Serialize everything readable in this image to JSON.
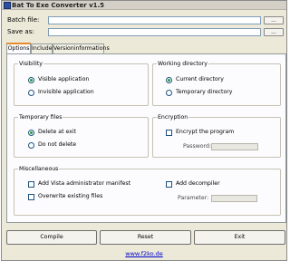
{
  "window": {
    "title": "Bat To Exe Converter v1.5"
  },
  "fields": {
    "batch_label": "Batch file:",
    "batch_value": "",
    "batch_browse": "...",
    "save_label": "Save as:",
    "save_value": "",
    "save_browse": "..."
  },
  "tabs": [
    {
      "label": "Options",
      "active": true
    },
    {
      "label": "Include",
      "active": false
    },
    {
      "label": "Versioninformations",
      "active": false
    }
  ],
  "visibility": {
    "title": "Visibility",
    "options": [
      "Visible application",
      "Invisible application"
    ],
    "selected": "Visible application"
  },
  "working_directory": {
    "title": "Working directory",
    "options": [
      "Current directory",
      "Temporary directory"
    ],
    "selected": "Current directory"
  },
  "temporary_files": {
    "title": "Temporary files",
    "options": [
      "Delete at exit",
      "Do not delete"
    ],
    "selected": "Delete at exit"
  },
  "encryption": {
    "title": "Encryption",
    "checkbox": "Encrypt the program",
    "checked": false,
    "password_label": "Password:",
    "password_value": ""
  },
  "miscellaneous": {
    "title": "Miscellaneous",
    "checkboxes": [
      {
        "label": "Add Vista administrator manifest",
        "checked": false
      },
      {
        "label": "Overwrite existing files",
        "checked": false
      },
      {
        "label": "Add decompiler",
        "checked": false
      }
    ],
    "parameter_label": "Parameter:",
    "parameter_value": ""
  },
  "buttons": {
    "compile": "Compile",
    "reset": "Reset",
    "exit": "Exit"
  },
  "footer_link": "www.f2ko.de"
}
